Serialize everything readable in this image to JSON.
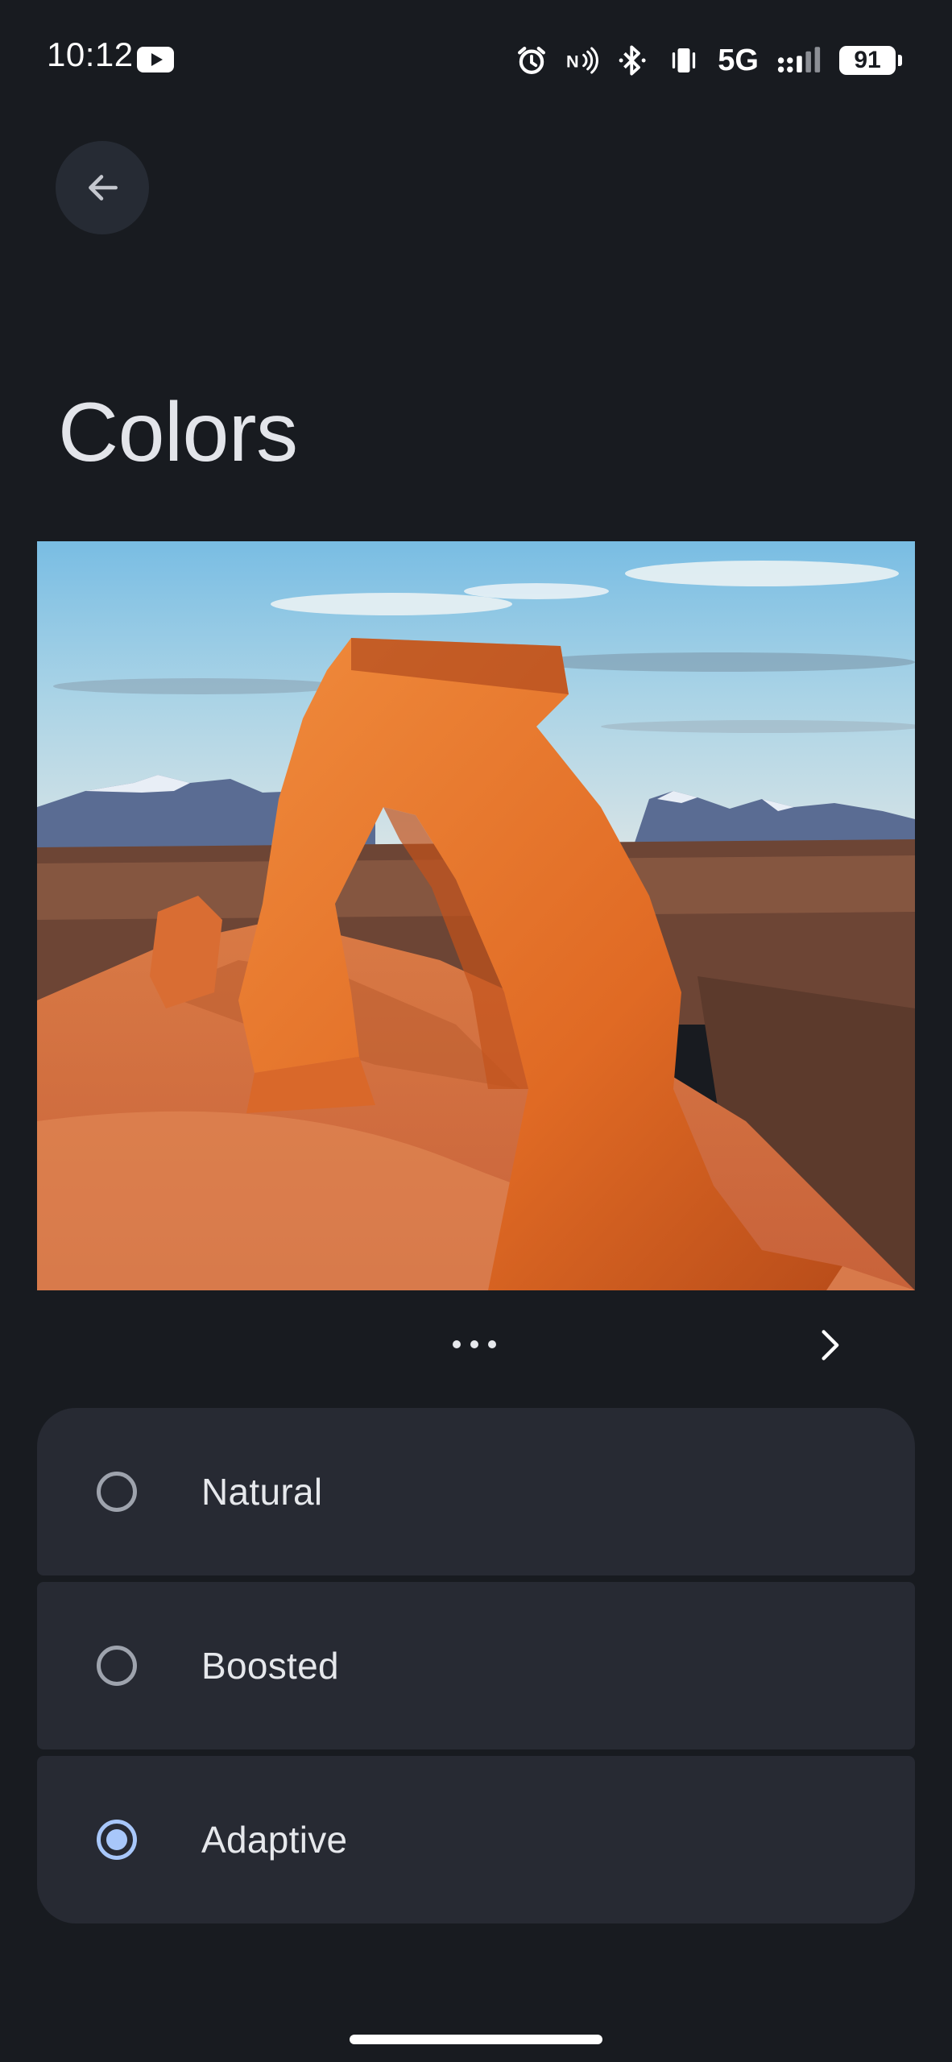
{
  "status_bar": {
    "time": "10:12",
    "network": "5G",
    "battery": "91",
    "icons": [
      "youtube-icon",
      "alarm-icon",
      "nfc-icon",
      "bluetooth-icon",
      "vibrate-icon",
      "signal-icon",
      "battery-icon"
    ]
  },
  "header": {
    "back_icon": "arrow-left-icon",
    "title": "Colors"
  },
  "preview": {
    "image": "sandstone-arch-landscape",
    "pager_dots": 3,
    "next_icon": "chevron-right-icon"
  },
  "color_modes": {
    "selected": "Adaptive",
    "options": [
      {
        "label": "Natural",
        "checked": false
      },
      {
        "label": "Boosted",
        "checked": false
      },
      {
        "label": "Adaptive",
        "checked": true
      }
    ]
  },
  "colors": {
    "background": "#181b20",
    "card": "#272a33",
    "accent": "#a8c7fa",
    "radio_unchecked": "#9ea3ad"
  }
}
